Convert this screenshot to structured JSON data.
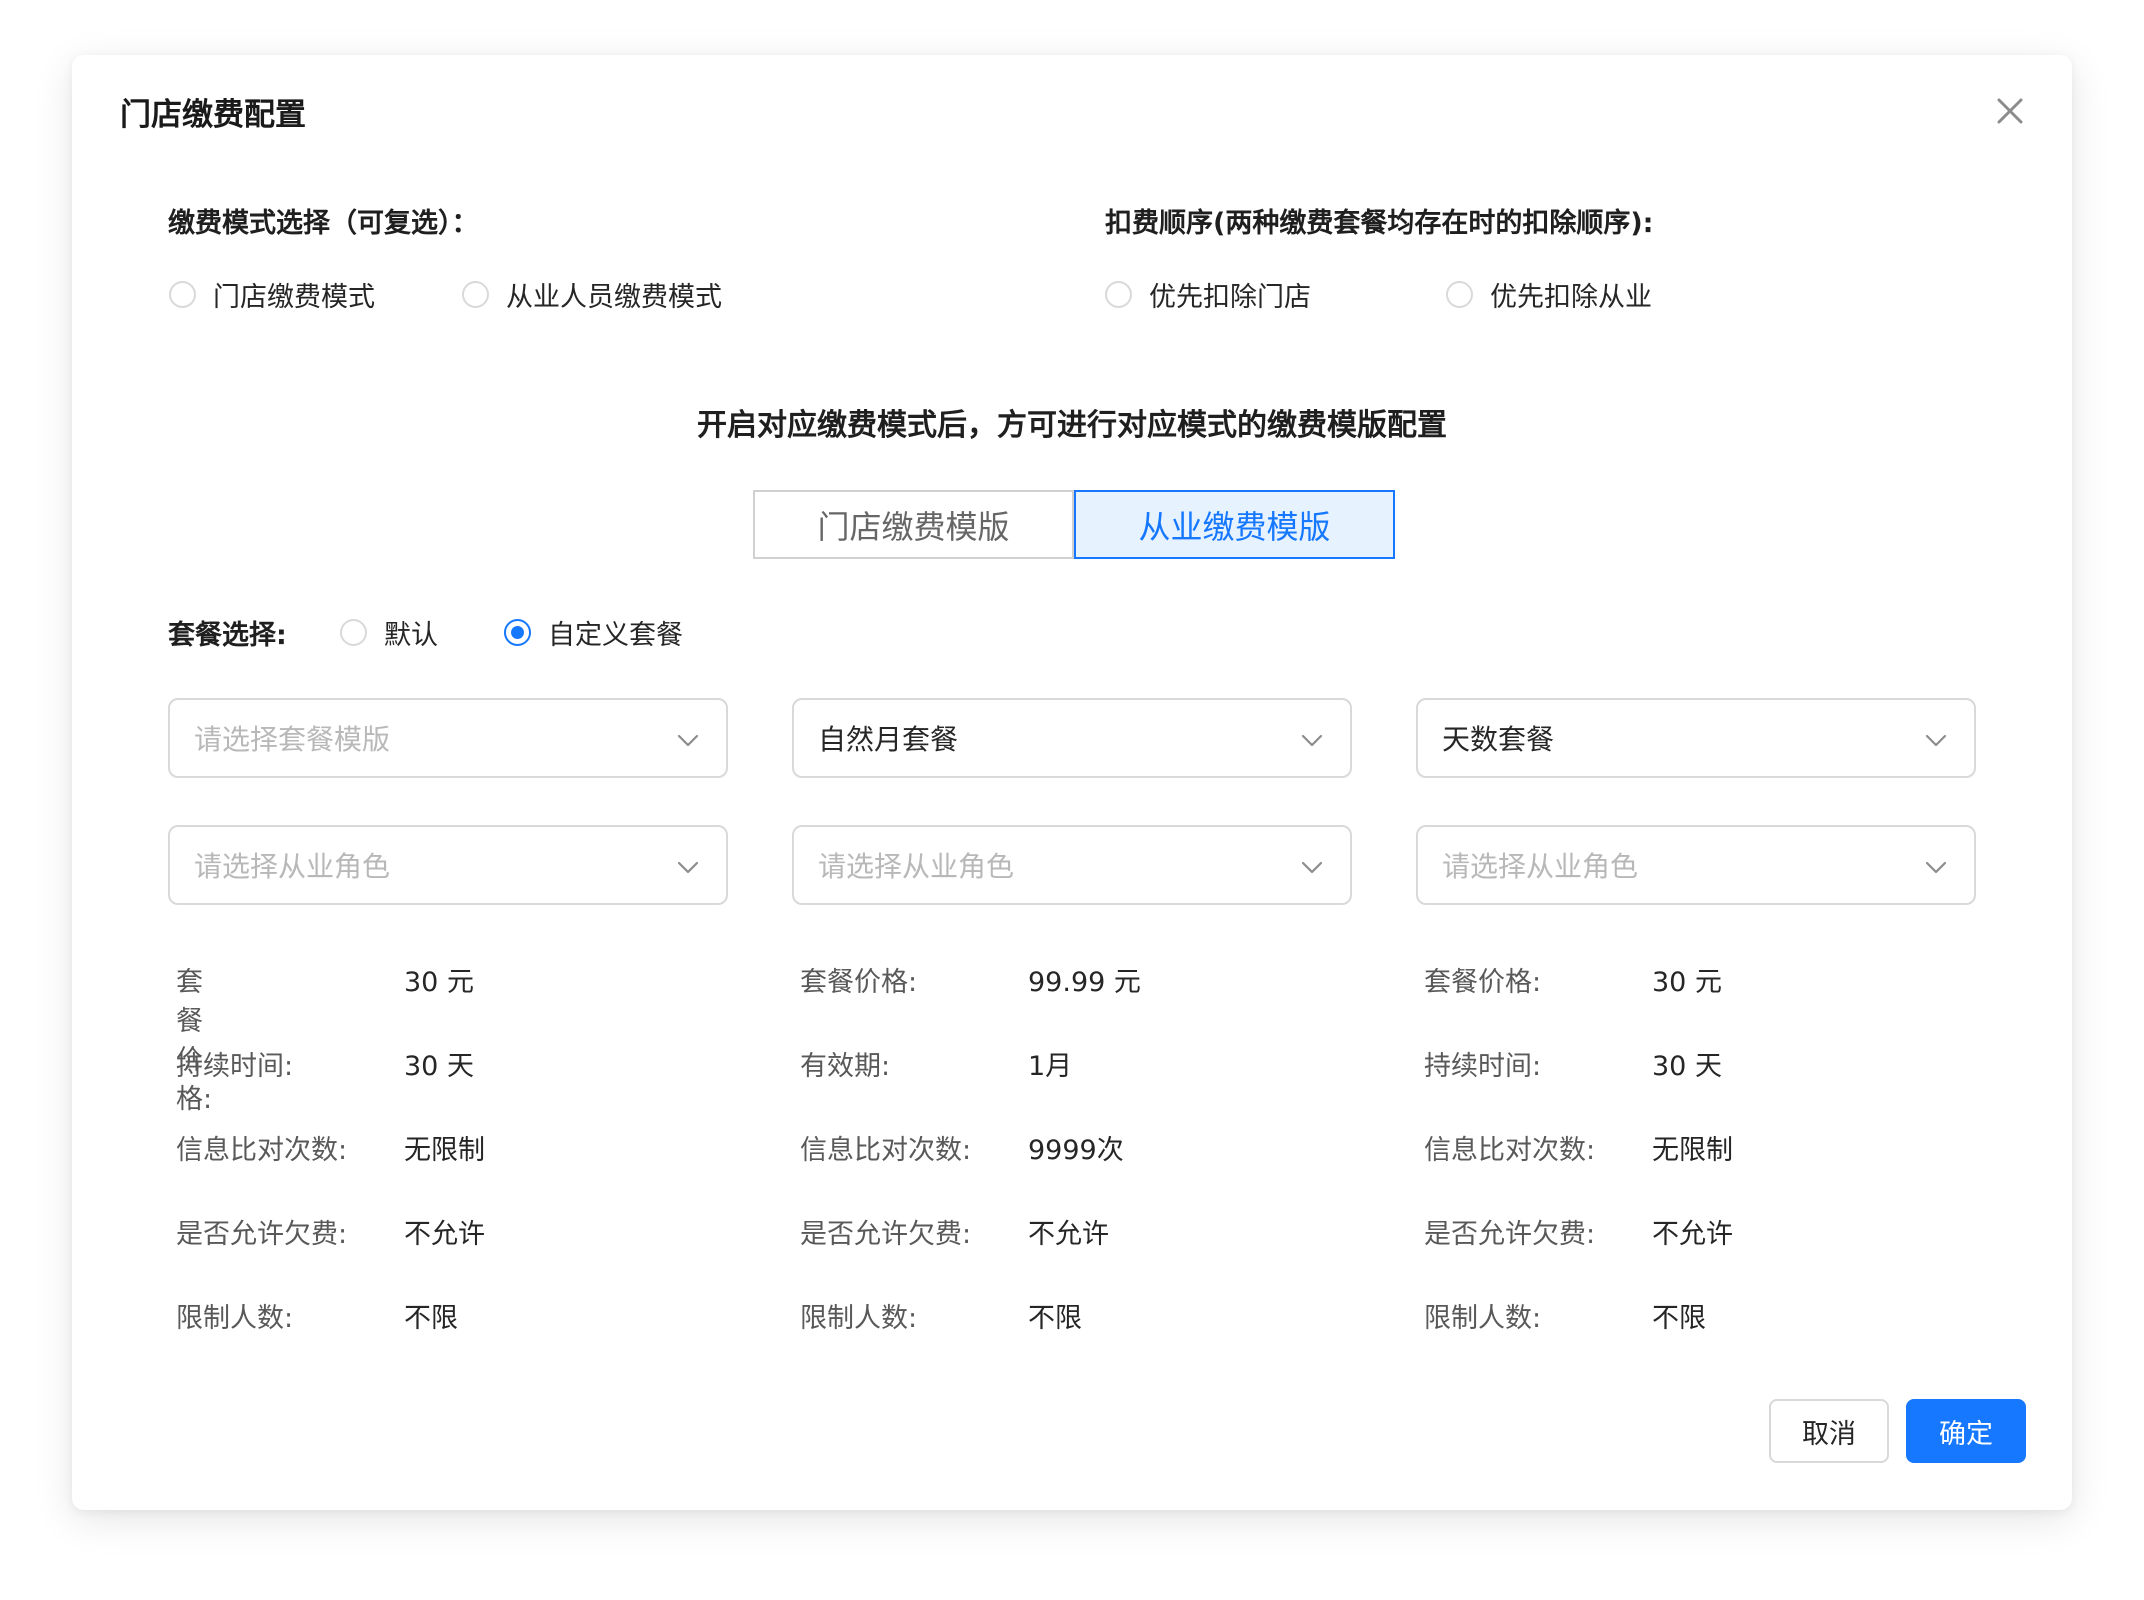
{
  "dialog": {
    "title": "门店缴费配置",
    "close_icon": "close-icon"
  },
  "mode": {
    "label": "缴费模式选择（可复选）：",
    "options": [
      {
        "label": "门店缴费模式",
        "checked": false
      },
      {
        "label": "从业人员缴费模式",
        "checked": false
      }
    ]
  },
  "order": {
    "label": "扣费顺序(两种缴费套餐均存在时的扣除顺序):",
    "options": [
      {
        "label": "优先扣除门店",
        "checked": false
      },
      {
        "label": "优先扣除从业",
        "checked": false
      }
    ]
  },
  "notice": "开启对应缴费模式后，方可进行对应模式的缴费模版配置",
  "tabs": [
    {
      "label": "门店缴费模版",
      "active": false
    },
    {
      "label": "从业缴费模版",
      "active": true
    }
  ],
  "package": {
    "label": "套餐选择:",
    "options": [
      {
        "label": "默认",
        "checked": false
      },
      {
        "label": "自定义套餐",
        "checked": true
      }
    ]
  },
  "columns": [
    {
      "template_select": {
        "value": "",
        "placeholder": "请选择套餐模版"
      },
      "role_select": {
        "value": "",
        "placeholder": "请选择从业角色"
      },
      "rows": [
        {
          "label": "套餐价格:",
          "value": "30 元"
        },
        {
          "label": "持续时间:",
          "value": "30 天"
        },
        {
          "label": "信息比对次数:",
          "value": "无限制"
        },
        {
          "label": "是否允许欠费:",
          "value": "不允许"
        },
        {
          "label": "限制人数:",
          "value": "不限"
        }
      ]
    },
    {
      "template_select": {
        "value": "自然月套餐",
        "placeholder": ""
      },
      "role_select": {
        "value": "",
        "placeholder": "请选择从业角色"
      },
      "rows": [
        {
          "label": "套餐价格:",
          "value": "99.99 元"
        },
        {
          "label": "有效期:",
          "value": "1月"
        },
        {
          "label": "信息比对次数:",
          "value": "9999次"
        },
        {
          "label": "是否允许欠费:",
          "value": "不允许"
        },
        {
          "label": "限制人数:",
          "value": "不限"
        }
      ]
    },
    {
      "template_select": {
        "value": "天数套餐",
        "placeholder": ""
      },
      "role_select": {
        "value": "",
        "placeholder": "请选择从业角色"
      },
      "rows": [
        {
          "label": "套餐价格:",
          "value": "30 元"
        },
        {
          "label": "持续时间:",
          "value": "30 天"
        },
        {
          "label": "信息比对次数:",
          "value": "无限制"
        },
        {
          "label": "是否允许欠费:",
          "value": "不允许"
        },
        {
          "label": "限制人数:",
          "value": "不限"
        }
      ]
    }
  ],
  "footer": {
    "cancel_label": "取消",
    "ok_label": "确定"
  },
  "colors": {
    "primary": "#1677ff",
    "tab_active_bg": "#e6f3ff",
    "placeholder": "#b8b8b8",
    "border": "#d9d9d9"
  }
}
